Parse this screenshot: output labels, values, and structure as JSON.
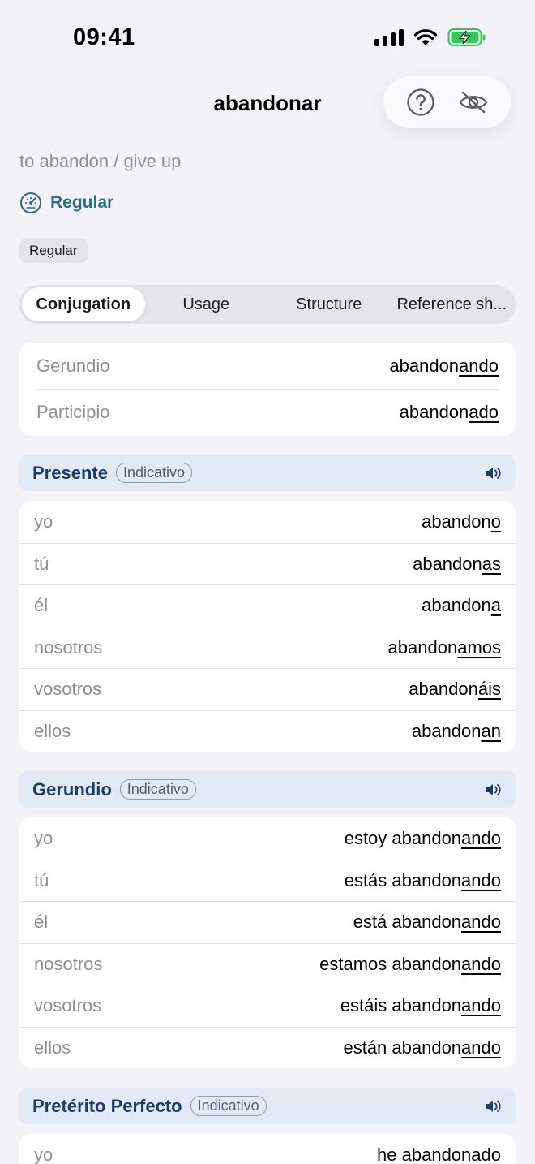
{
  "status_bar": {
    "time": "09:41"
  },
  "header": {
    "title": "abandonar",
    "help_icon": "question-circle-icon",
    "hide_icon": "eye-slash-icon"
  },
  "translation": "to abandon / give up",
  "regularity_link": {
    "label": "Regular",
    "icon": "gauge-icon"
  },
  "regularity_tag": "Regular",
  "tabs": [
    {
      "label": "Conjugation",
      "active": true
    },
    {
      "label": "Usage",
      "active": false
    },
    {
      "label": "Structure",
      "active": false
    },
    {
      "label": "Reference sh...",
      "active": false
    }
  ],
  "forms": [
    {
      "label": "Gerundio",
      "stem": "abandon",
      "ending": "ando"
    },
    {
      "label": "Participio",
      "stem": "abandon",
      "ending": "ado"
    }
  ],
  "tenses": [
    {
      "name": "Presente",
      "mood": "Indicativo",
      "rows": [
        {
          "pronoun": "yo",
          "stem": "abandon",
          "ending": "o"
        },
        {
          "pronoun": "tú",
          "stem": "abandon",
          "ending": "as"
        },
        {
          "pronoun": "él",
          "stem": "abandon",
          "ending": "a"
        },
        {
          "pronoun": "nosotros",
          "stem": "abandon",
          "ending": "amos"
        },
        {
          "pronoun": "vosotros",
          "stem": "abandon",
          "ending": "áis"
        },
        {
          "pronoun": "ellos",
          "stem": "abandon",
          "ending": "an"
        }
      ]
    },
    {
      "name": "Gerundio",
      "mood": "Indicativo",
      "rows": [
        {
          "pronoun": "yo",
          "stem": "estoy abandon",
          "ending": "ando"
        },
        {
          "pronoun": "tú",
          "stem": "estás abandon",
          "ending": "ando"
        },
        {
          "pronoun": "él",
          "stem": "está abandon",
          "ending": "ando"
        },
        {
          "pronoun": "nosotros",
          "stem": "estamos abandon",
          "ending": "ando"
        },
        {
          "pronoun": "vosotros",
          "stem": "estáis abandon",
          "ending": "ando"
        },
        {
          "pronoun": "ellos",
          "stem": "están abandon",
          "ending": "ando"
        }
      ]
    },
    {
      "name": "Pretérito Perfecto",
      "mood": "Indicativo",
      "rows": [
        {
          "pronoun": "yo",
          "stem": "he abandon",
          "ending": "ado"
        }
      ]
    }
  ],
  "colors": {
    "background": "#f2f2f7",
    "accent": "#2a6f7f",
    "tense_header_bg": "#e2eaf6",
    "tense_title": "#1f3b64",
    "battery_green": "#34c759"
  }
}
